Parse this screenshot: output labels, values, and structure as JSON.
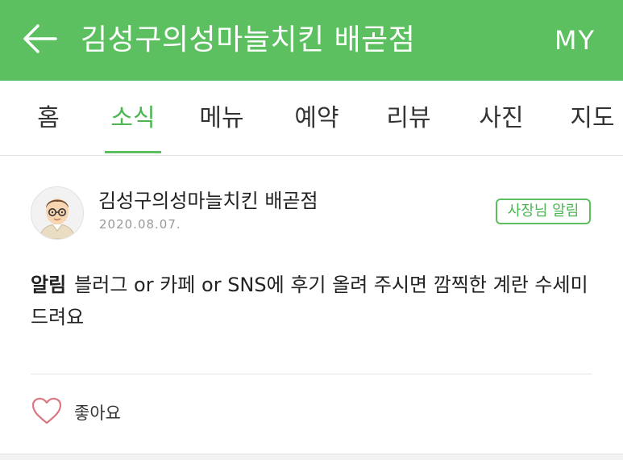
{
  "header": {
    "title": "김성구의성마늘치킨 배곧점",
    "my_label": "MY",
    "bg_color": "#5cbf60"
  },
  "tabs": [
    {
      "label": "홈",
      "active": false
    },
    {
      "label": "소식",
      "active": true
    },
    {
      "label": "메뉴",
      "active": false
    },
    {
      "label": "예약",
      "active": false
    },
    {
      "label": "리뷰",
      "active": false
    },
    {
      "label": "사진",
      "active": false
    },
    {
      "label": "지도",
      "active": false
    }
  ],
  "post": {
    "author": "김성구의성마늘치킨 배곧점",
    "date": "2020.08.07.",
    "badge": "사장님 알림",
    "keyword": "알림",
    "body": "블러그 or 카페 or SNS에 후기 올려 주시면 깜찍한 계란 수세미드려요",
    "like_label": "좋아요",
    "avatar_icon": "owner-avatar-icon",
    "like_icon": "heart-icon"
  }
}
